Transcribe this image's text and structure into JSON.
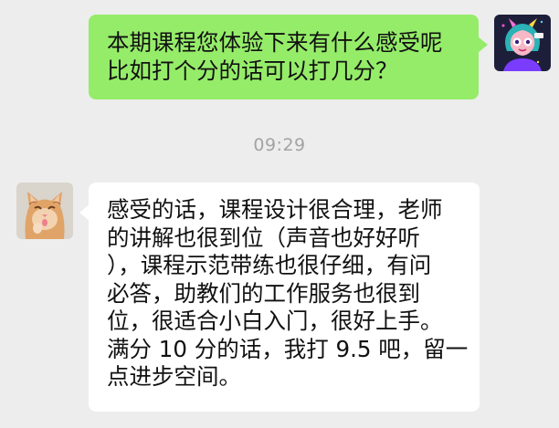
{
  "messages": {
    "sent": {
      "lines": [
        "本期课程您体验下来有什么感受呢",
        "比如打个分的话可以打几分？"
      ],
      "bubble_color": "#95ec69"
    },
    "received": {
      "lines": [
        "感受的话，课程设计很合理，老师",
        "的讲解也很到位（声音也好好听",
        "），课程示范带练也很仔细，有问",
        "必答，助教们的工作服务也很到",
        "位，很适合小白入门，很好上手。",
        "满分 10 分的话，我打 9.5 吧，留一",
        "点进步空间。"
      ],
      "bubble_color": "#ffffff"
    }
  },
  "timestamp": "09:29",
  "avatars": {
    "me": "cartoon-girl-avatar",
    "other": "orange-kitten-avatar"
  },
  "background_color": "#ededed"
}
